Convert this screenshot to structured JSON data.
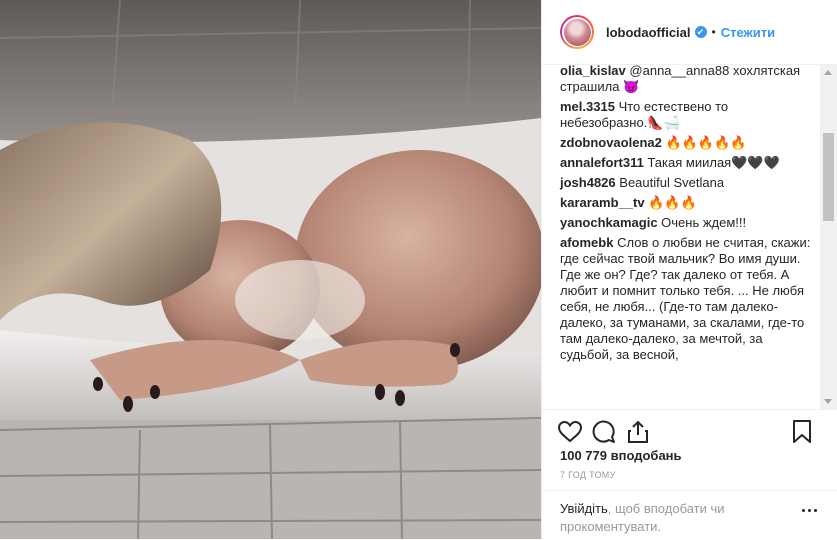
{
  "header": {
    "username": "lobodaofficial",
    "verified_mark": "✔",
    "separator": "•",
    "follow_label": "Стежити"
  },
  "comments": [
    {
      "user": "olia_kislav",
      "text": "@anna__anna88 хохлятская страшила 😈"
    },
    {
      "user": "mel.3315",
      "text": "Что естествено то небезобразно.👠🛁"
    },
    {
      "user": "zdobnovaolena2",
      "text": "🔥🔥🔥🔥🔥"
    },
    {
      "user": "annalefort311",
      "text": "Такая миилая🖤🖤🖤"
    },
    {
      "user": "josh4826",
      "text": "Beautiful Svetlana"
    },
    {
      "user": "kararamb__tv",
      "text": "🔥🔥🔥"
    },
    {
      "user": "yanochkamagic",
      "text": "Очень ждем!!!"
    },
    {
      "user": "afomebk",
      "text": "Слов о любви не считая, скажи: где сейчас твой мальчик? Во имя души. Где же он? Где? так далеко от тебя. А любит и помнит только тебя. ... Не любя себя, не любя... (Где-то там далеко-далеко, за туманами, за скалами, где-то там далеко-далеко, за мечтой, за судьбой, за весной,"
    }
  ],
  "icons": {
    "like": "heart-icon",
    "comment": "comment-icon",
    "share": "share-icon",
    "save": "bookmark-icon",
    "more": "more-options-icon"
  },
  "likes_text": "100 779 вподобань",
  "time_text": "7 ГОД ТОМУ",
  "login": {
    "link": "Увійдіть",
    "rest": ", щоб вподобати чи прокоментувати."
  }
}
